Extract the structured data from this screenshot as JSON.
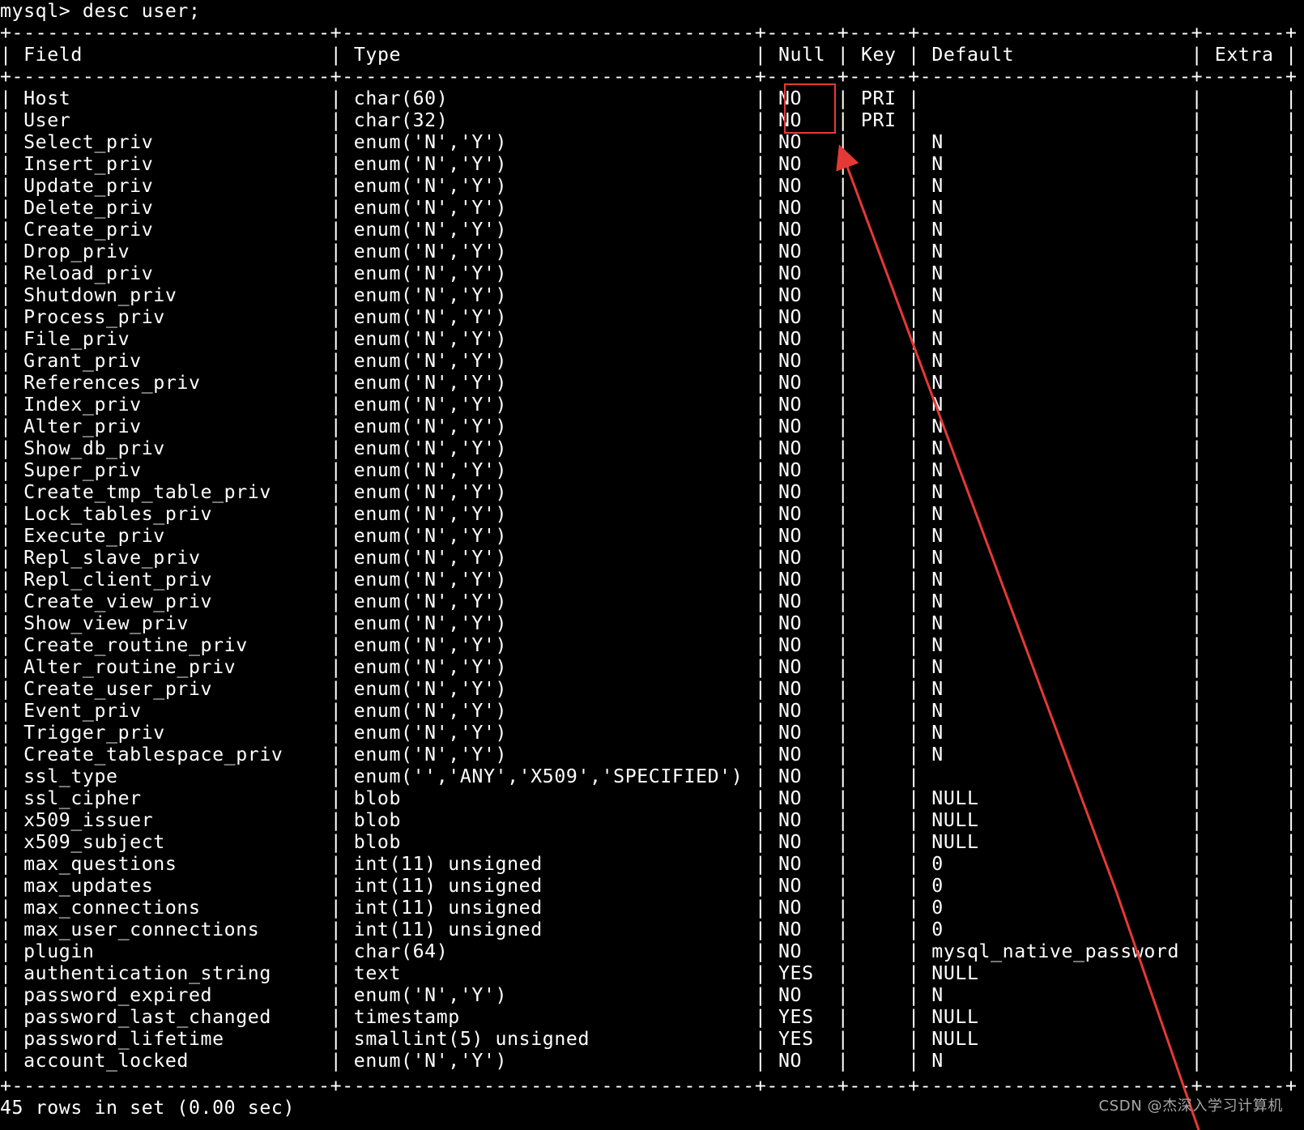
{
  "terminal": {
    "prompt_line": "mysql> desc user;",
    "separator": "+---------------------------+-----------------------------------+------+-----+-----------------------+-------+",
    "header": {
      "field": "Field",
      "type": "Type",
      "null": "Null",
      "key": "Key",
      "default": "Default",
      "extra": "Extra"
    },
    "rows": [
      {
        "field": "Host",
        "type": "char(60)",
        "null": "NO",
        "key": "PRI",
        "default": "",
        "extra": ""
      },
      {
        "field": "User",
        "type": "char(32)",
        "null": "NO",
        "key": "PRI",
        "default": "",
        "extra": ""
      },
      {
        "field": "Select_priv",
        "type": "enum('N','Y')",
        "null": "NO",
        "key": "",
        "default": "N",
        "extra": ""
      },
      {
        "field": "Insert_priv",
        "type": "enum('N','Y')",
        "null": "NO",
        "key": "",
        "default": "N",
        "extra": ""
      },
      {
        "field": "Update_priv",
        "type": "enum('N','Y')",
        "null": "NO",
        "key": "",
        "default": "N",
        "extra": ""
      },
      {
        "field": "Delete_priv",
        "type": "enum('N','Y')",
        "null": "NO",
        "key": "",
        "default": "N",
        "extra": ""
      },
      {
        "field": "Create_priv",
        "type": "enum('N','Y')",
        "null": "NO",
        "key": "",
        "default": "N",
        "extra": ""
      },
      {
        "field": "Drop_priv",
        "type": "enum('N','Y')",
        "null": "NO",
        "key": "",
        "default": "N",
        "extra": ""
      },
      {
        "field": "Reload_priv",
        "type": "enum('N','Y')",
        "null": "NO",
        "key": "",
        "default": "N",
        "extra": ""
      },
      {
        "field": "Shutdown_priv",
        "type": "enum('N','Y')",
        "null": "NO",
        "key": "",
        "default": "N",
        "extra": ""
      },
      {
        "field": "Process_priv",
        "type": "enum('N','Y')",
        "null": "NO",
        "key": "",
        "default": "N",
        "extra": ""
      },
      {
        "field": "File_priv",
        "type": "enum('N','Y')",
        "null": "NO",
        "key": "",
        "default": "N",
        "extra": ""
      },
      {
        "field": "Grant_priv",
        "type": "enum('N','Y')",
        "null": "NO",
        "key": "",
        "default": "N",
        "extra": ""
      },
      {
        "field": "References_priv",
        "type": "enum('N','Y')",
        "null": "NO",
        "key": "",
        "default": "N",
        "extra": ""
      },
      {
        "field": "Index_priv",
        "type": "enum('N','Y')",
        "null": "NO",
        "key": "",
        "default": "N",
        "extra": ""
      },
      {
        "field": "Alter_priv",
        "type": "enum('N','Y')",
        "null": "NO",
        "key": "",
        "default": "N",
        "extra": ""
      },
      {
        "field": "Show_db_priv",
        "type": "enum('N','Y')",
        "null": "NO",
        "key": "",
        "default": "N",
        "extra": ""
      },
      {
        "field": "Super_priv",
        "type": "enum('N','Y')",
        "null": "NO",
        "key": "",
        "default": "N",
        "extra": ""
      },
      {
        "field": "Create_tmp_table_priv",
        "type": "enum('N','Y')",
        "null": "NO",
        "key": "",
        "default": "N",
        "extra": ""
      },
      {
        "field": "Lock_tables_priv",
        "type": "enum('N','Y')",
        "null": "NO",
        "key": "",
        "default": "N",
        "extra": ""
      },
      {
        "field": "Execute_priv",
        "type": "enum('N','Y')",
        "null": "NO",
        "key": "",
        "default": "N",
        "extra": ""
      },
      {
        "field": "Repl_slave_priv",
        "type": "enum('N','Y')",
        "null": "NO",
        "key": "",
        "default": "N",
        "extra": ""
      },
      {
        "field": "Repl_client_priv",
        "type": "enum('N','Y')",
        "null": "NO",
        "key": "",
        "default": "N",
        "extra": ""
      },
      {
        "field": "Create_view_priv",
        "type": "enum('N','Y')",
        "null": "NO",
        "key": "",
        "default": "N",
        "extra": ""
      },
      {
        "field": "Show_view_priv",
        "type": "enum('N','Y')",
        "null": "NO",
        "key": "",
        "default": "N",
        "extra": ""
      },
      {
        "field": "Create_routine_priv",
        "type": "enum('N','Y')",
        "null": "NO",
        "key": "",
        "default": "N",
        "extra": ""
      },
      {
        "field": "Alter_routine_priv",
        "type": "enum('N','Y')",
        "null": "NO",
        "key": "",
        "default": "N",
        "extra": ""
      },
      {
        "field": "Create_user_priv",
        "type": "enum('N','Y')",
        "null": "NO",
        "key": "",
        "default": "N",
        "extra": ""
      },
      {
        "field": "Event_priv",
        "type": "enum('N','Y')",
        "null": "NO",
        "key": "",
        "default": "N",
        "extra": ""
      },
      {
        "field": "Trigger_priv",
        "type": "enum('N','Y')",
        "null": "NO",
        "key": "",
        "default": "N",
        "extra": ""
      },
      {
        "field": "Create_tablespace_priv",
        "type": "enum('N','Y')",
        "null": "NO",
        "key": "",
        "default": "N",
        "extra": ""
      },
      {
        "field": "ssl_type",
        "type": "enum('','ANY','X509','SPECIFIED')",
        "null": "NO",
        "key": "",
        "default": "",
        "extra": ""
      },
      {
        "field": "ssl_cipher",
        "type": "blob",
        "null": "NO",
        "key": "",
        "default": "NULL",
        "extra": ""
      },
      {
        "field": "x509_issuer",
        "type": "blob",
        "null": "NO",
        "key": "",
        "default": "NULL",
        "extra": ""
      },
      {
        "field": "x509_subject",
        "type": "blob",
        "null": "NO",
        "key": "",
        "default": "NULL",
        "extra": ""
      },
      {
        "field": "max_questions",
        "type": "int(11) unsigned",
        "null": "NO",
        "key": "",
        "default": "0",
        "extra": ""
      },
      {
        "field": "max_updates",
        "type": "int(11) unsigned",
        "null": "NO",
        "key": "",
        "default": "0",
        "extra": ""
      },
      {
        "field": "max_connections",
        "type": "int(11) unsigned",
        "null": "NO",
        "key": "",
        "default": "0",
        "extra": ""
      },
      {
        "field": "max_user_connections",
        "type": "int(11) unsigned",
        "null": "NO",
        "key": "",
        "default": "0",
        "extra": ""
      },
      {
        "field": "plugin",
        "type": "char(64)",
        "null": "NO",
        "key": "",
        "default": "mysql_native_password",
        "extra": ""
      },
      {
        "field": "authentication_string",
        "type": "text",
        "null": "YES",
        "key": "",
        "default": "NULL",
        "extra": ""
      },
      {
        "field": "password_expired",
        "type": "enum('N','Y')",
        "null": "NO",
        "key": "",
        "default": "N",
        "extra": ""
      },
      {
        "field": "password_last_changed",
        "type": "timestamp",
        "null": "YES",
        "key": "",
        "default": "NULL",
        "extra": ""
      },
      {
        "field": "password_lifetime",
        "type": "smallint(5) unsigned",
        "null": "YES",
        "key": "",
        "default": "NULL",
        "extra": ""
      },
      {
        "field": "account_locked",
        "type": "enum('N','Y')",
        "null": "NO",
        "key": "",
        "default": "N",
        "extra": ""
      }
    ],
    "footer": "45 rows in set (0.00 sec)"
  },
  "annotation": {
    "color": "#e53935"
  },
  "watermark": "CSDN @杰深入学习计算机"
}
